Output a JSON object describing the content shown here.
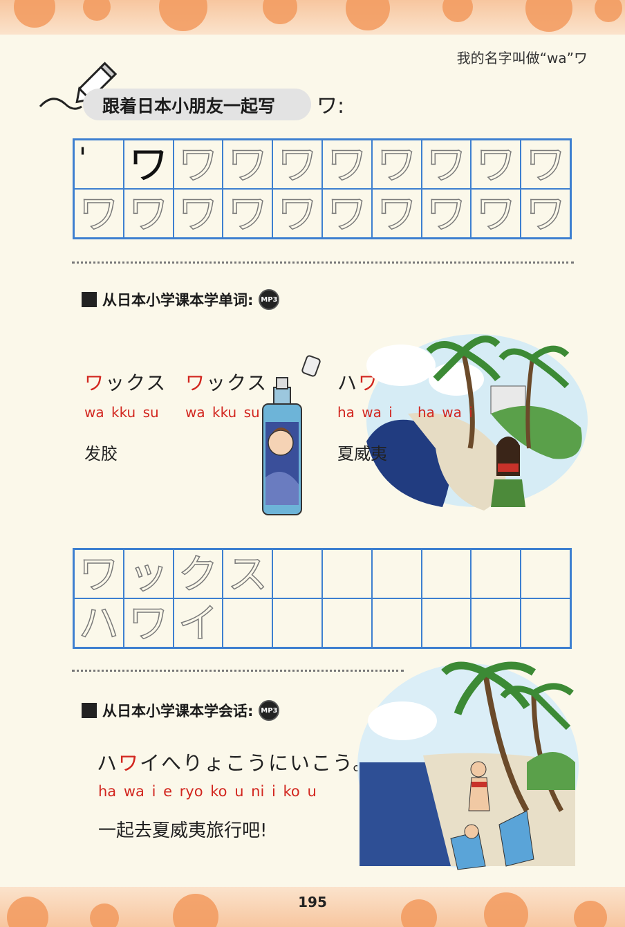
{
  "header": {
    "title": "我的名字叫做“wa”ワ"
  },
  "practice": {
    "title": "跟着日本小朋友一起写",
    "kana": "ワ:",
    "stroke_step": "'",
    "char": "ワ"
  },
  "vocab": {
    "heading": "从日本小学课本学单词:",
    "mp3": "MP3",
    "words": [
      {
        "kana_red": "ワ",
        "kana_rest": "ックス",
        "romaji_red": "wa",
        "romaji_rest": "kku su"
      },
      {
        "kana_red": "ワ",
        "kana_rest": "ックス",
        "romaji_red": "wa",
        "romaji_rest": "kku su"
      },
      {
        "kana_pre": "ハ",
        "kana_red": "ワ",
        "kana_rest": "イ",
        "romaji": "ha wa i"
      },
      {
        "kana_pre": "ハ",
        "kana_red": "ワ",
        "kana_rest": "イ",
        "romaji": "ha wa i"
      }
    ],
    "meaning_wax": "发胶",
    "meaning_hawaii": "夏威夷",
    "trace_row1": [
      "ワ",
      "ッ",
      "ク",
      "ス"
    ],
    "trace_row2": [
      "ハ",
      "ワ",
      "イ"
    ]
  },
  "conversation": {
    "heading": "从日本小学课本学会话:",
    "mp3": "MP3",
    "kana_pre": "ハ",
    "kana_red": "ワ",
    "kana_rest": "イへりょこうにいこう。",
    "romaji": "ha wa i e ryo ko u ni i ko u",
    "meaning": "一起去夏威夷旅行吧!"
  },
  "footer": {
    "page_number": "195"
  },
  "colors": {
    "accent_red": "#d2261f",
    "grid_blue": "#3d7fd0",
    "border_orange": "#f29a5e"
  }
}
